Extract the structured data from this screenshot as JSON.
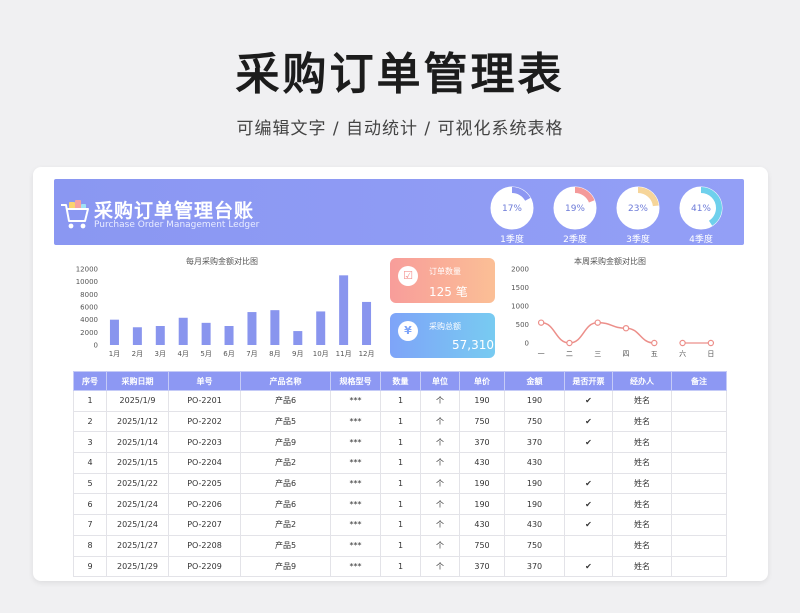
{
  "page": {
    "title": "采购订单管理表",
    "subtitle": "可编辑文字 / 自动统计 / 可视化系统表格"
  },
  "banner": {
    "title": "采购订单管理台账",
    "subtitle": "Purchase Order Management Ledger",
    "icon": "shopping-cart-icon",
    "quarters": [
      {
        "percent": 17,
        "label": "1季度",
        "value_text": "17%",
        "color": "#8d97f2"
      },
      {
        "percent": 19,
        "label": "2季度",
        "value_text": "19%",
        "color": "#f49a9a"
      },
      {
        "percent": 23,
        "label": "3季度",
        "value_text": "23%",
        "color": "#f6d59a"
      },
      {
        "percent": 41,
        "label": "4季度",
        "value_text": "41%",
        "color": "#6fd0ec"
      }
    ]
  },
  "stats": {
    "orders": {
      "label": "订单数量",
      "value": "125  笔",
      "icon": "clipboard-icon",
      "icon_glyph": "☑"
    },
    "total": {
      "label": "采购总额",
      "value": "57,310.00",
      "icon": "yen-icon",
      "icon_glyph": "¥"
    }
  },
  "chart_data": [
    {
      "type": "bar",
      "title": "每月采购金额对比图",
      "categories": [
        "1月",
        "2月",
        "3月",
        "4月",
        "5月",
        "6月",
        "7月",
        "8月",
        "9月",
        "10月",
        "11月",
        "12月"
      ],
      "values": [
        4000,
        2800,
        3000,
        4300,
        3500,
        3000,
        5200,
        5500,
        2200,
        5300,
        11000,
        6800
      ],
      "ylim": [
        0,
        12000
      ],
      "yticks": [
        "12000",
        "10000",
        "8000",
        "6000",
        "4000",
        "2000",
        "0"
      ],
      "color": "#8995ee"
    },
    {
      "type": "line",
      "title": "本周采购金额对比图",
      "categories": [
        "一",
        "二",
        "三",
        "四",
        "五",
        "六",
        "日"
      ],
      "values": [
        550,
        0,
        550,
        400,
        0,
        0,
        0
      ],
      "ylim": [
        0,
        2000
      ],
      "yticks": [
        "2000",
        "1500",
        "1000",
        "500",
        "0"
      ],
      "color": "#ec8f8a"
    }
  ],
  "table": {
    "headers": [
      "序号",
      "采购日期",
      "单号",
      "产品名称",
      "规格型号",
      "数量",
      "单位",
      "单价",
      "金额",
      "是否开票",
      "经办人",
      "备注"
    ],
    "rows": [
      [
        "1",
        "2025/1/9",
        "PO-2201",
        "产品6",
        "***",
        "1",
        "个",
        "190",
        "190",
        "✔",
        "姓名",
        ""
      ],
      [
        "2",
        "2025/1/12",
        "PO-2202",
        "产品5",
        "***",
        "1",
        "个",
        "750",
        "750",
        "✔",
        "姓名",
        ""
      ],
      [
        "3",
        "2025/1/14",
        "PO-2203",
        "产品9",
        "***",
        "1",
        "个",
        "370",
        "370",
        "✔",
        "姓名",
        ""
      ],
      [
        "4",
        "2025/1/15",
        "PO-2204",
        "产品2",
        "***",
        "1",
        "个",
        "430",
        "430",
        "",
        "姓名",
        ""
      ],
      [
        "5",
        "2025/1/22",
        "PO-2205",
        "产品6",
        "***",
        "1",
        "个",
        "190",
        "190",
        "✔",
        "姓名",
        ""
      ],
      [
        "6",
        "2025/1/24",
        "PO-2206",
        "产品6",
        "***",
        "1",
        "个",
        "190",
        "190",
        "✔",
        "姓名",
        ""
      ],
      [
        "7",
        "2025/1/24",
        "PO-2207",
        "产品2",
        "***",
        "1",
        "个",
        "430",
        "430",
        "✔",
        "姓名",
        ""
      ],
      [
        "8",
        "2025/1/27",
        "PO-2208",
        "产品5",
        "***",
        "1",
        "个",
        "750",
        "750",
        "",
        "姓名",
        ""
      ],
      [
        "9",
        "2025/1/29",
        "PO-2209",
        "产品9",
        "***",
        "1",
        "个",
        "370",
        "370",
        "✔",
        "姓名",
        ""
      ]
    ]
  }
}
